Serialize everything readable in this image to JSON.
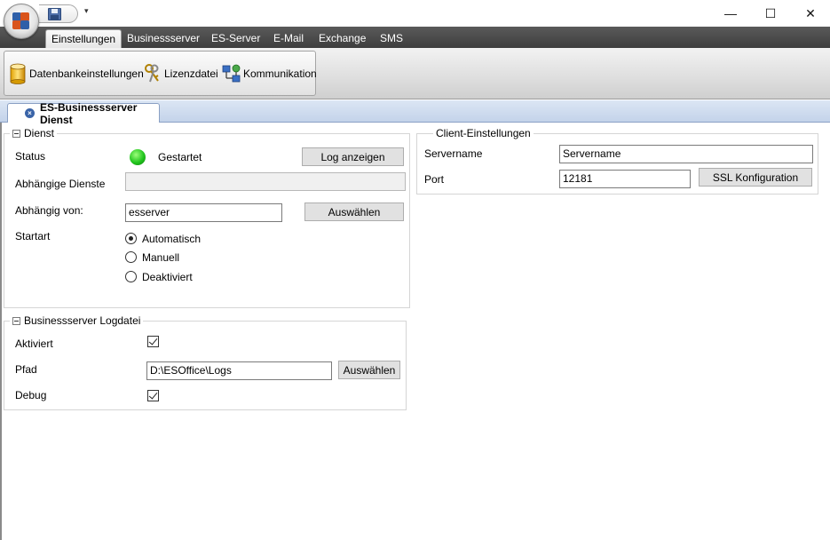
{
  "window": {
    "minimize_glyph": "—",
    "maximize_glyph": "☐",
    "close_glyph": "✕",
    "qat_dropdown_glyph": "▾"
  },
  "ribbon": {
    "tabs": [
      {
        "label": "Einstellungen",
        "active": true
      },
      {
        "label": "Businessserver"
      },
      {
        "label": "ES-Server"
      },
      {
        "label": "E-Mail"
      },
      {
        "label": "Exchange"
      },
      {
        "label": "SMS"
      }
    ],
    "buttons": [
      {
        "label": "Datenbankeinstellungen",
        "icon": "database-icon"
      },
      {
        "label": "Lizenzdatei",
        "icon": "keys-icon"
      },
      {
        "label": "Kommunikation",
        "icon": "network-icon"
      }
    ]
  },
  "document_tab": {
    "title": "ES-Businessserver Dienst",
    "close_glyph": "×"
  },
  "dienst": {
    "title": "Dienst",
    "status_label": "Status",
    "status_value": "Gestartet",
    "status_color": "#22c51e",
    "log_button": "Log anzeigen",
    "abhaengige_dienste_label": "Abhängige Dienste",
    "abhaengige_dienste_value": "",
    "abhaengig_von_label": "Abhängig von:",
    "abhaengig_von_value": "esserver",
    "auswaehlen_button": "Auswählen",
    "startart_label": "Startart",
    "startart_options": [
      {
        "label": "Automatisch",
        "selected": true
      },
      {
        "label": "Manuell",
        "selected": false
      },
      {
        "label": "Deaktiviert",
        "selected": false
      }
    ]
  },
  "logdatei": {
    "title": "Businessserver Logdatei",
    "aktiviert_label": "Aktiviert",
    "aktiviert_checked": true,
    "pfad_label": "Pfad",
    "pfad_value": "D:\\ESOffice\\Logs",
    "auswaehlen_button": "Auswählen",
    "debug_label": "Debug",
    "debug_checked": true
  },
  "client": {
    "title": "Client-Einstellungen",
    "servername_label": "Servername",
    "servername_value": "Servername",
    "port_label": "Port",
    "port_value": "12181",
    "ssl_button": "SSL Konfiguration"
  }
}
